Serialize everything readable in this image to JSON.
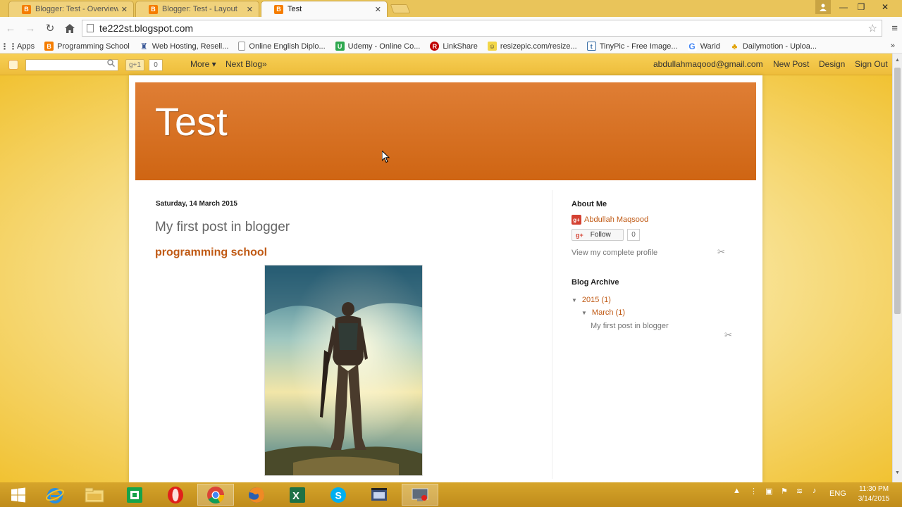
{
  "browser": {
    "tabs": [
      {
        "label": "Blogger: Test - Overview",
        "active": false
      },
      {
        "label": "Blogger: Test - Layout",
        "active": false
      },
      {
        "label": "Test",
        "active": true
      }
    ],
    "url": "te222st.blogspot.com",
    "bookmarks": [
      {
        "label": "Apps",
        "icon": "apps-grid-icon",
        "color": "#555555"
      },
      {
        "label": "Programming School",
        "icon": "blogger-icon",
        "color": "#f57d00"
      },
      {
        "label": "Web Hosting, Resell...",
        "icon": "hosting-icon",
        "color": "#3b5998"
      },
      {
        "label": "Online English Diplo...",
        "icon": "page-icon",
        "color": "#999999"
      },
      {
        "label": "Udemy - Online Co...",
        "icon": "udemy-icon",
        "color": "#2fa84f"
      },
      {
        "label": "LinkShare",
        "icon": "linkshare-icon",
        "color": "#c00000"
      },
      {
        "label": "resizepic.com/resize...",
        "icon": "resizepic-icon",
        "color": "#d9b300"
      },
      {
        "label": "TinyPic - Free Image...",
        "icon": "tinypic-icon",
        "color": "#3a6ea5"
      },
      {
        "label": "Warid",
        "icon": "google-icon",
        "color": "#4285f4"
      },
      {
        "label": "Dailymotion - Uploa...",
        "icon": "dailymotion-icon",
        "color": "#e0a000"
      }
    ]
  },
  "navbar": {
    "gplus_label": "g+1",
    "gplus_count": "0",
    "more_label": "More ▾",
    "next_blog_label": "Next Blog»",
    "email": "abdullahmaqood@gmail.com",
    "new_post_label": "New Post",
    "design_label": "Design",
    "sign_out_label": "Sign Out"
  },
  "blog": {
    "title": "Test",
    "post": {
      "date": "Saturday, 14 March 2015",
      "title": "My first post in blogger",
      "subtitle": "programming school"
    },
    "sidebar": {
      "about_heading": "About Me",
      "profile_name": "Abdullah Maqsood",
      "follow_label": "Follow",
      "follow_count": "0",
      "profile_link": "View my complete profile",
      "archive_heading": "Blog Archive",
      "archive_year": "2015 (1)",
      "archive_month": "March (1)",
      "archive_post": "My first post in blogger"
    }
  },
  "taskbar": {
    "language": "ENG",
    "time": "11:30 PM",
    "date": "3/14/2015"
  },
  "colors": {
    "accent_orange": "#cf6513",
    "page_yellow": "#f1c232",
    "link_orange": "#c05a15"
  }
}
